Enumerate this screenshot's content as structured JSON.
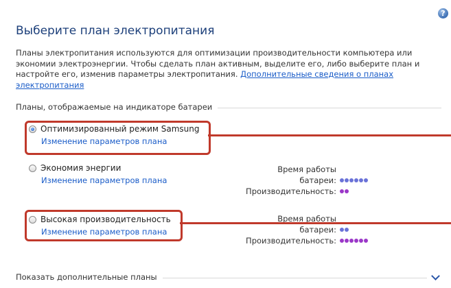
{
  "page": {
    "title": "Выберите план электропитания",
    "description": "Планы электропитания используются для оптимизации производительности компьютера или экономии электроэнергии. Чтобы сделать план активным, выделите его, либо выберите план и настройте его, изменив параметры электропитания.",
    "description_link": "Дополнительные сведения о планах электропитания"
  },
  "section": {
    "title": "Планы, отображаемые на индикаторе батареи"
  },
  "plans": [
    {
      "name": "Оптимизированный режим Samsung",
      "link": "Изменение параметров плана",
      "selected": true
    },
    {
      "name": "Экономия энергии",
      "link": "Изменение параметров плана",
      "selected": false,
      "battery_label_1": "Время работы",
      "battery_label_2": "батареи:",
      "battery_level": 6,
      "performance_label": "Производительность:",
      "performance_level": 2
    },
    {
      "name": "Высокая производительность",
      "link": "Изменение параметров плана",
      "selected": false,
      "battery_label_1": "Время работы",
      "battery_label_2": "батареи:",
      "battery_level": 2,
      "performance_label": "Производительность:",
      "performance_level": 6
    }
  ],
  "footer": {
    "show_more": "Показать дополнительные планы"
  },
  "colors": {
    "title": "#1c3f7a",
    "link": "#1a5cc8",
    "battery_dots": "#6a72d8",
    "performance_dots": "#9b38c8",
    "highlight": "#c0392b"
  },
  "icons": {
    "help": "help-icon",
    "expand": "chevron-down-icon"
  }
}
